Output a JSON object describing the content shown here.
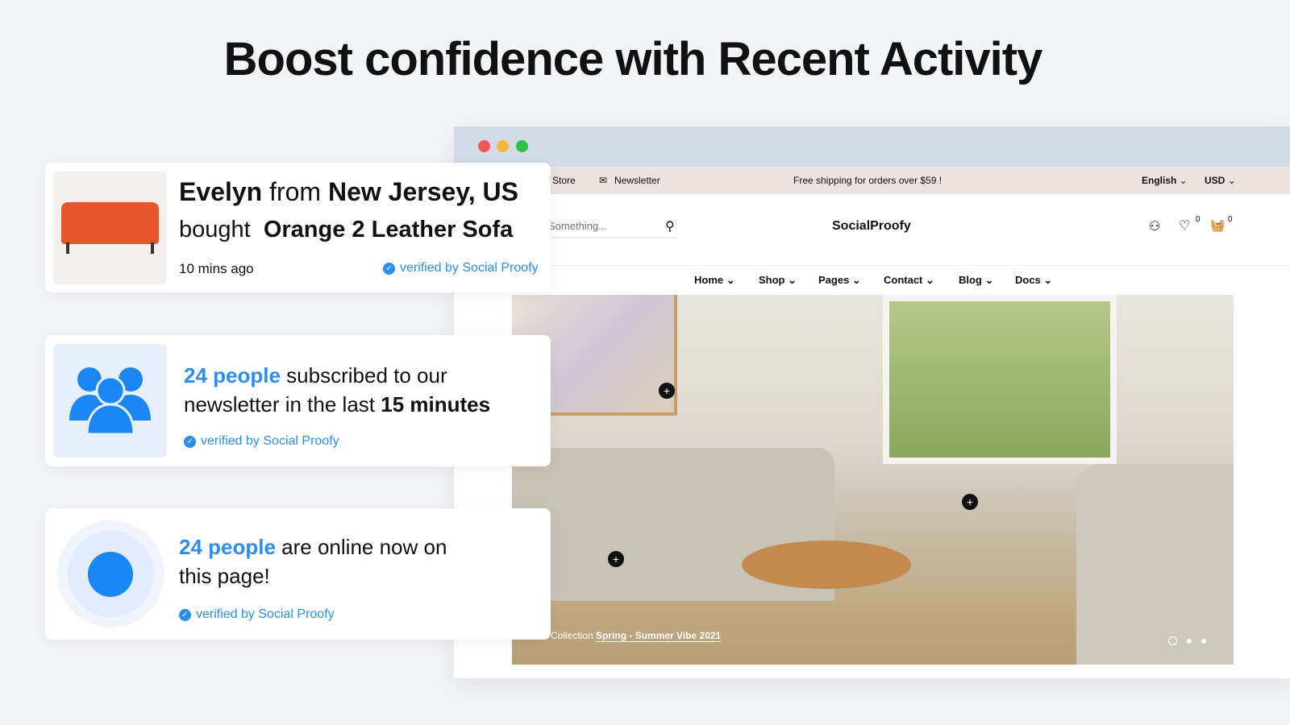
{
  "headline": "Boost confidence with Recent Activity",
  "browser": {
    "announcement": {
      "store": "Store",
      "newsletter": "Newsletter",
      "shipping": "Free shipping for orders over $59 !",
      "language": "English",
      "currency": "USD"
    },
    "header": {
      "search_placeholder": "Something...",
      "logo": "SocialProofy",
      "wishlist_count": "0",
      "cart_count": "0"
    },
    "nav": [
      "Home",
      "Shop",
      "Pages",
      "Contact",
      "Blog",
      "Docs"
    ],
    "hero": {
      "caption_prefix": "Collection",
      "caption_link": "Spring - Summer Vibe 2021"
    }
  },
  "cards": [
    {
      "name": "Evelyn",
      "from": "from",
      "location": "New Jersey, US",
      "bought": "bought",
      "product": "Orange 2 Leather Sofa",
      "time": "10 mins ago",
      "verified": "verified by Social Proofy"
    },
    {
      "count": "24 people",
      "text1": "subscribed to our",
      "text2": "newsletter in the last",
      "duration": "15 minutes",
      "verified": "verified by Social Proofy"
    },
    {
      "count": "24 people",
      "text1": "are online now on",
      "text2": "this page!",
      "verified": "verified by Social Proofy"
    }
  ],
  "colors": {
    "accent": "#2b8ef0",
    "background": "#f3f4f8",
    "announcement_bg": "#ece3df",
    "chrome": "#d3dbe8"
  }
}
